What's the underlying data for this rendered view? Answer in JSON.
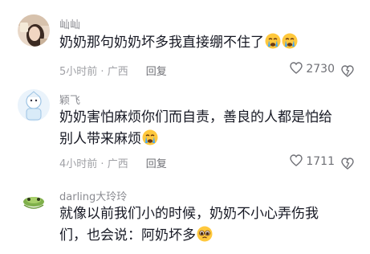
{
  "comments": [
    {
      "username": "屾屾",
      "text": "奶奶那句奶奶坏多我直接绷不住了",
      "emojis": [
        "crying-emoji",
        "crying-emoji"
      ],
      "time": "5小时前",
      "location": "广西",
      "reply_label": "回复",
      "likes": "2730"
    },
    {
      "username": "颖飞",
      "text_line1": "奶奶害怕麻烦你们而自责，善良的人都是怕给",
      "text_line2": "别人带来麻烦",
      "emojis": [
        "crying-emoji"
      ],
      "time": "4小时前",
      "location": "广西",
      "reply_label": "回复",
      "likes": "1711"
    },
    {
      "username": "darling大玲玲",
      "text_line1": "就像以前我们小的时候，奶奶不小心弄伤我",
      "text_line2": "们，也会说：阿奶坏多",
      "emojis": [
        "pleading-emoji"
      ]
    }
  ],
  "colors": {
    "username": "#8a8b91",
    "body_text": "#161823",
    "meta_text": "#a0a1a6",
    "emoji_yellow": "#ffc83d",
    "tear_blue": "#3fa6f5"
  }
}
